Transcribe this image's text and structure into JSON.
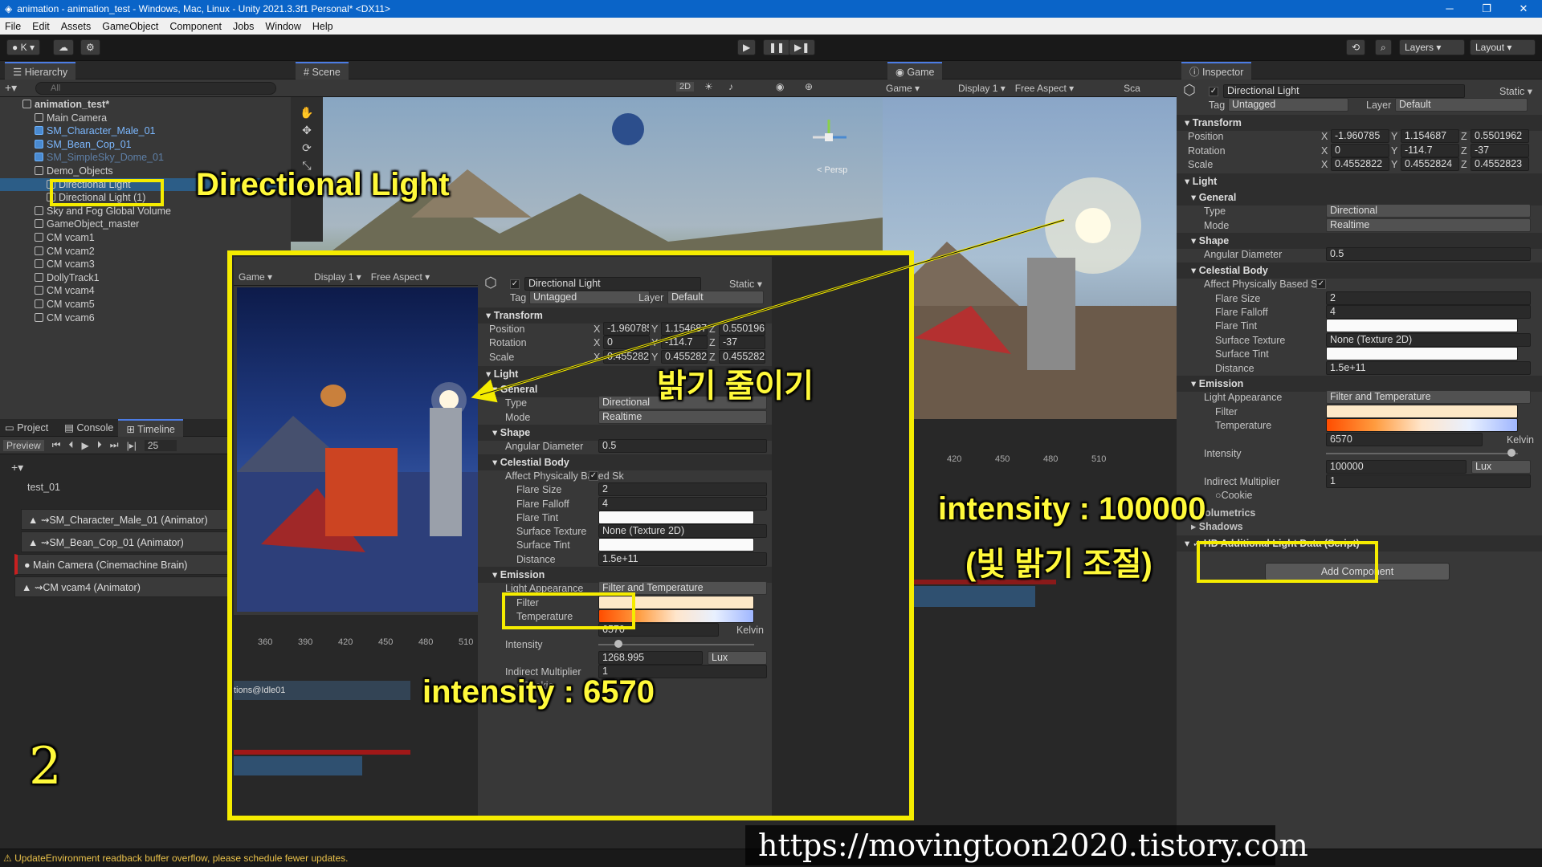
{
  "window": {
    "title": "animation - animation_test - Windows, Mac, Linux - Unity 2021.3.3f1 Personal* <DX11>",
    "min": "─",
    "max": "❐",
    "close": "✕"
  },
  "menu": [
    "File",
    "Edit",
    "Assets",
    "GameObject",
    "Component",
    "Jobs",
    "Window",
    "Help"
  ],
  "toolbar": {
    "account": "K",
    "layers": "Layers",
    "layout": "Layout",
    "play": "▶",
    "pause": "❚❚",
    "step": "▶❚"
  },
  "hierarchy": {
    "title": "Hierarchy",
    "search_placeholder": "All",
    "items": [
      {
        "label": "animation_test*",
        "indent": 0,
        "bold": true
      },
      {
        "label": "Main Camera",
        "indent": 1
      },
      {
        "label": "SM_Character_Male_01",
        "indent": 1,
        "blue": true
      },
      {
        "label": "SM_Bean_Cop_01",
        "indent": 1,
        "blue": true
      },
      {
        "label": "SM_SimpleSky_Dome_01",
        "indent": 1,
        "blue": true,
        "dim": true
      },
      {
        "label": "Demo_Objects",
        "indent": 1
      },
      {
        "label": "Directional Light",
        "indent": 2,
        "selected": true
      },
      {
        "label": "Directional Light (1)",
        "indent": 2
      },
      {
        "label": "Sky and Fog Global Volume",
        "indent": 1
      },
      {
        "label": "GameObject_master",
        "indent": 1
      },
      {
        "label": "CM vcam1",
        "indent": 1
      },
      {
        "label": "CM vcam2",
        "indent": 1
      },
      {
        "label": "CM vcam3",
        "indent": 1
      },
      {
        "label": "DollyTrack1",
        "indent": 1
      },
      {
        "label": "CM vcam4",
        "indent": 1
      },
      {
        "label": "CM vcam5",
        "indent": 1
      },
      {
        "label": "CM vcam6",
        "indent": 1
      }
    ]
  },
  "scene": {
    "title": "Scene",
    "mode2d": "2D",
    "persp": "< Persp"
  },
  "game": {
    "title": "Game",
    "display_mode": "Game",
    "display": "Display 1",
    "aspect": "Free Aspect",
    "scale": "Sca"
  },
  "project": {
    "tabs": [
      "Project",
      "Console",
      "Timeline"
    ],
    "preview": "Preview",
    "frame": "25",
    "asset": "test_01",
    "tracks": [
      "SM_Character_Male_01 (Animator)",
      "SM_Bean_Cop_01 (Animator)",
      "Main Camera (Cinemachine Brain)",
      "CM vcam4 (Animator)"
    ]
  },
  "timeline_ruler": [
    "360",
    "390",
    "420",
    "450",
    "480",
    "510"
  ],
  "inspector": {
    "title": "Inspector",
    "object": "Directional Light",
    "static": "Static",
    "tag_label": "Tag",
    "tag": "Untagged",
    "layer_label": "Layer",
    "layer": "Default",
    "transform": {
      "title": "Transform",
      "position_label": "Position",
      "rotation_label": "Rotation",
      "scale_label": "Scale",
      "px": "-1.960785",
      "py": "1.154687",
      "pz": "0.5501962",
      "rx": "0",
      "ry": "-114.7",
      "rz": "-37",
      "sx": "0.4552822",
      "sy": "0.4552824",
      "sz": "0.4552823"
    },
    "light": {
      "title": "Light",
      "general": "General",
      "type_label": "Type",
      "type": "Directional",
      "mode_label": "Mode",
      "mode": "Realtime",
      "shape": "Shape",
      "angular_label": "Angular Diameter",
      "angular": "0.5",
      "celestial": "Celestial Body",
      "affect_label": "Affect Physically Based Sk",
      "flare_size_label": "Flare Size",
      "flare_size": "2",
      "flare_falloff_label": "Flare Falloff",
      "flare_falloff": "4",
      "flare_tint_label": "Flare Tint",
      "surface_texture_label": "Surface Texture",
      "surface_texture": "None (Texture 2D)",
      "surface_tint_label": "Surface Tint",
      "distance_label": "Distance",
      "distance": "1.5e+11",
      "emission": "Emission",
      "appearance_label": "Light Appearance",
      "appearance": "Filter and Temperature",
      "filter_label": "Filter",
      "temperature_label": "Temperature",
      "temperature": "6570",
      "kelvin": "Kelvin",
      "intensity_label": "Intensity",
      "intensity": "100000",
      "lux": "Lux",
      "indirect_label": "Indirect Multiplier",
      "indirect": "1",
      "cookie": "Cookie",
      "volumetrics": "Volumetrics",
      "shadows": "Shadows"
    },
    "hd": "HD Additional Light Data (Script)",
    "add_component": "Add Component"
  },
  "overlay_inspector": {
    "intensity_old": "1268.995",
    "temperature": "6570",
    "lux": "Lux",
    "indirect": "1",
    "volumetrics": "Volumetrics"
  },
  "overlay_timeline": {
    "clip": "tions@Idle01"
  },
  "annotations": {
    "directional_light": "Directional Light",
    "reduce_brightness": "밝기 줄이기",
    "intensity_6570": "intensity : 6570",
    "intensity_100000": "intensity : 100000",
    "light_adjust": "(빛 밝기 조절)",
    "step": "2",
    "watermark": "https://movingtoon2020.tistory.com"
  },
  "status": {
    "message": "UpdateEnvironment readback buffer overflow, please schedule fewer updates."
  },
  "colors": {
    "annotation": "#f5ec00",
    "selection": "#2c5d87",
    "title_bar": "#0a64c8"
  }
}
